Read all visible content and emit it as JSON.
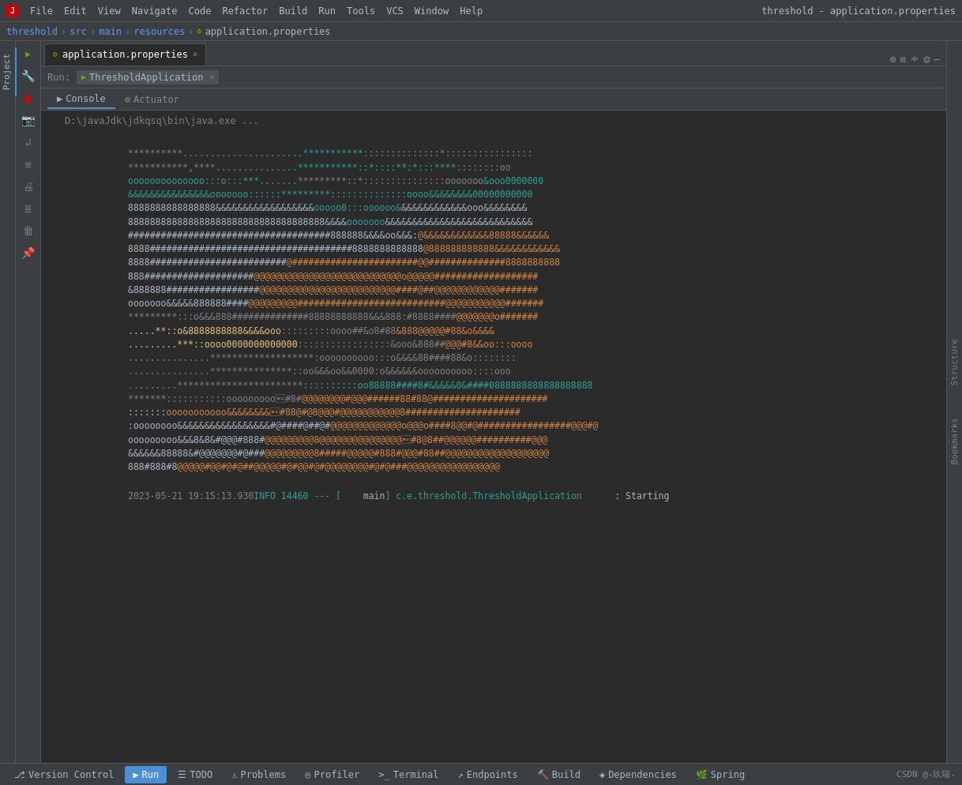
{
  "titleBar": {
    "title": "threshold - application.properties",
    "menus": [
      "File",
      "Edit",
      "View",
      "Navigate",
      "Code",
      "Refactor",
      "Build",
      "Run",
      "Tools",
      "VCS",
      "Window",
      "Help"
    ]
  },
  "breadcrumb": {
    "project": "threshold",
    "src": "src",
    "main": "main",
    "resources": "resources",
    "file": "application.properties"
  },
  "editorTab": {
    "icon": "●",
    "label": "application.properties",
    "closeIcon": "×"
  },
  "runBar": {
    "label": "Run:",
    "config": "ThresholdApplication",
    "closeIcon": "×"
  },
  "consoleTabs": [
    {
      "label": "Console",
      "icon": "▶",
      "active": true
    },
    {
      "label": "Actuator",
      "icon": "⚙",
      "active": false
    }
  ],
  "cmdLine": "D:\\javaJdk\\jdkqsq\\bin\\java.exe ...",
  "consoleLines": [
    {
      "text": "**********......................***********::::::::::::::::*::::::::::::::::",
      "classes": [
        "c-gray"
      ]
    },
    {
      "text": "***********,****...............***********::*::::**:*:::****::::::::oo",
      "classes": [
        "c-gray"
      ]
    },
    {
      "text": "oooooooooooooo:::o:::***.......*********::*:::::::::::::::ooooooo&ooo0000000",
      "classes": [
        "c-teal",
        "c-gray"
      ]
    },
    {
      "text": "&&&&&&&&&&&&&&&ooooooo::::::*********::::::::::::::oooo&&&&&&&&00000000000",
      "classes": [
        "c-teal"
      ]
    },
    {
      "text": "8888888888888888&&&&&&&&&&&&&&&&&&ooooo0:::oooooo&&&&&&&&&&&&&&ooo&&&&&&&&",
      "classes": [
        "c-white",
        "c-teal"
      ]
    },
    {
      "text": "888888888888888888888888888888888888&&&&ooooooo&&&&&&&&&&&&&&&&&&&&&&&&&&&",
      "classes": [
        "c-white"
      ]
    },
    {
      "text": "#####################################888888&&&&oo&&::@&&&&&&&&&&&&88888&&&&&&",
      "classes": [
        "c-white",
        "c-orange"
      ]
    },
    {
      "text": "8888#####################################8888888888888@888888888888&&&&&&&&&&&&",
      "classes": [
        "c-white",
        "c-orange"
      ]
    },
    {
      "text": "8888#########################@#######################@@##############8888888888",
      "classes": [
        "c-white",
        "c-orange"
      ]
    },
    {
      "text": "888####################@@@@@@@@@@@@@@@@@@@@@@@@@@@o@@@@@###################",
      "classes": [
        "c-white",
        "c-orange"
      ]
    },
    {
      "text": "&888888#################@@@@@@@@@@@@@@@@@@@@@@@@@####@##@@@@@@@@@@@@#######",
      "classes": [
        "c-white",
        "c-orange"
      ]
    },
    {
      "text": "ooooooo&&&&&888888####@@@@@@@@@###########################@@@@@@@@@@@#######",
      "classes": [
        "c-white",
        "c-orange"
      ]
    },
    {
      "text": "*********:::o&&&888##############88888888888&&&888:#8888####@@@@@@@o#######",
      "classes": [
        "c-gray",
        "c-white"
      ]
    },
    {
      "text": ".....**::o&8888888888&&&&ooo:::::::oooo##&o8#88&888@@@@@#88&o&&&&",
      "classes": [
        "c-yellow",
        "c-orange"
      ]
    },
    {
      "text": ".........***::oooo0000000000000:::::::::::::::&ooo&888##@@@#8&&oo:::oooo",
      "classes": [
        "c-yellow"
      ]
    },
    {
      "text": "...............*******************:oooooooooo:::o&&&&88####88&o::::::::",
      "classes": [
        "c-gray"
      ]
    },
    {
      "text": "...............***************::oo&&&oo&&0000:o&&&&&&oooooooooo::::ooo",
      "classes": [
        "c-gray"
      ]
    },
    {
      "text": ".........***********************:::::::::::oo88888####8#&&&&&0&####0888888888888888888",
      "classes": [
        "c-gray",
        "c-teal"
      ]
    },
    {
      "text": "*******:::::::::::ooooooooo&#8#8#@@@@@@@@#@@@######88#88@#####################",
      "classes": [
        "c-gray",
        "c-orange"
      ]
    },
    {
      "text": ":::::::ooooooooooooo&&&&&&&&&#8#88@#@8@@@#@@@@@@@@@@@8#####################",
      "classes": [
        "c-white",
        "c-orange"
      ]
    },
    {
      "text": ":oooooooo&&&&&&&&&&&&&&&&&#@####@##@#@@@@@@@@@@@@@o@@@o####8@@#@#################@@@#@",
      "classes": [
        "c-white",
        "c-orange"
      ]
    },
    {
      "text": "ooooooooo&&&8&8&#@@@#888#@@@@@@@@@8@@@@@@@@@@@@@@@&#8#8@8##@@@@@@##########@@@",
      "classes": [
        "c-white",
        "c-orange"
      ]
    },
    {
      "text": "&&&&&&88888&#@@@@@@@#@###@@@@@@@@@8#####@@@@@#888#@@@#88##@@@@@@@@@@@@@@@@@@@",
      "classes": [
        "c-white",
        "c-orange"
      ]
    },
    {
      "text": "888#888#8@@@@@#@@#@#@##@@@@@#@#@@#@#@@@@@@@@#@#@###@@@@@@@@@@@@@@@@@",
      "classes": [
        "c-white",
        "c-orange"
      ]
    }
  ],
  "statusLine": {
    "timestamp": "2023-05-21 19:15:13.930",
    "level": "INFO 14460 ---  [",
    "thread": "main]",
    "class": "c.e.threshold.ThresholdApplication",
    "message": ": Starting"
  },
  "statusBar": {
    "tabs": [
      {
        "label": "Version Control",
        "icon": "⎇",
        "active": false
      },
      {
        "label": "Run",
        "icon": "▶",
        "active": true
      },
      {
        "label": "TODO",
        "icon": "☰",
        "active": false
      },
      {
        "label": "Problems",
        "icon": "⚠",
        "active": false
      },
      {
        "label": "Profiler",
        "icon": "◎",
        "active": false
      },
      {
        "label": "Terminal",
        "icon": ">_",
        "active": false
      },
      {
        "label": "Endpoints",
        "icon": "↗",
        "active": false
      },
      {
        "label": "Build",
        "icon": "🔨",
        "active": false
      },
      {
        "label": "Dependencies",
        "icon": "◈",
        "active": false
      },
      {
        "label": "Spring",
        "icon": "🌿",
        "active": false
      }
    ],
    "rightText": "CSDN @-玖瑞-"
  },
  "sidebarLeft": {
    "tabs": [
      {
        "label": "Project",
        "active": true
      }
    ]
  },
  "sidebarRight": {
    "tabs": [
      "Structure",
      "Bookmarks"
    ]
  },
  "toolIcons": [
    "↑",
    "↓",
    "■",
    "◷",
    "↲",
    "≡",
    "🖨",
    "≣",
    "🗑",
    "📌"
  ],
  "projectHeader": {
    "label": "Project",
    "dropIcon": "▼"
  }
}
